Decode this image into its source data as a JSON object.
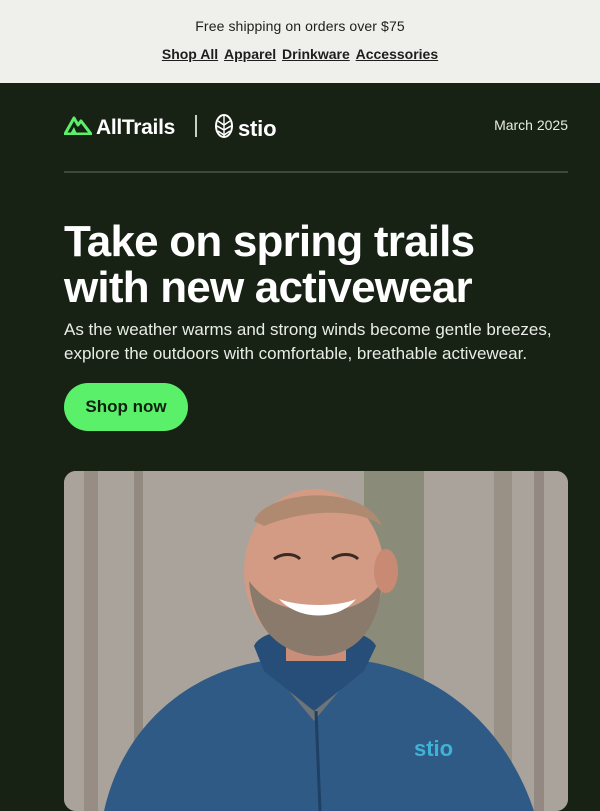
{
  "announcement": {
    "shipping_text": "Free shipping on orders over $75"
  },
  "nav": {
    "items": [
      {
        "label": "Shop All"
      },
      {
        "label": "Apparel"
      },
      {
        "label": "Drinkware"
      },
      {
        "label": "Accessories"
      }
    ]
  },
  "header": {
    "brand_primary": "AllTrails",
    "brand_partner": "stio",
    "date": "March 2025"
  },
  "hero": {
    "headline_line1": "Take on spring trails",
    "headline_line2": "with new activewear",
    "subtext_line1": "As the weather warms and strong winds become gentle breezes,",
    "subtext_line2": "explore the outdoors with comfortable, breathable activewear.",
    "cta_label": "Shop now",
    "photo_logo_text": "stio"
  },
  "colors": {
    "hero_bg": "#172114",
    "top_bar_bg": "#efefeb",
    "cta_green": "#5af06a",
    "alltrails_green": "#5af06a",
    "jacket_blue": "#2f5a86",
    "jacket_logo": "#3fb3d6"
  },
  "icons": {
    "alltrails_logo": "mountain-icon",
    "stio_logo": "pinecone-icon"
  }
}
